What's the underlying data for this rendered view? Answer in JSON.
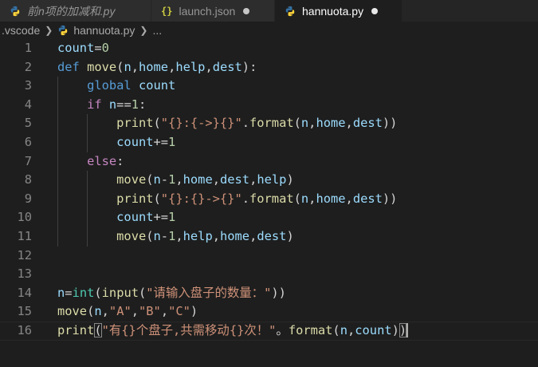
{
  "tabs": [
    {
      "label": "前n项的加减和.py",
      "icon": "python-icon",
      "active": false,
      "dirty": false,
      "italic": true
    },
    {
      "label": "launch.json",
      "icon": "json-icon",
      "active": false,
      "dirty": true,
      "italic": false
    },
    {
      "label": "hannuota.py",
      "icon": "python-icon",
      "active": true,
      "dirty": true,
      "italic": false
    }
  ],
  "json_icon_glyph": "{}",
  "breadcrumb": {
    "folder": ".vscode",
    "file": "hannuota.py",
    "ellipsis": "..."
  },
  "colors": {
    "background": "#1e1e1e",
    "tabbar": "#252526",
    "python_blue": "#3572a5",
    "python_yellow": "#ffd43b"
  },
  "lines": [
    {
      "num": "1",
      "indent": 0,
      "tokens": [
        [
          "var",
          "count"
        ],
        [
          "op",
          "="
        ],
        [
          "num",
          "0"
        ]
      ]
    },
    {
      "num": "2",
      "indent": 0,
      "tokens": [
        [
          "kw",
          "def "
        ],
        [
          "fn",
          "move"
        ],
        [
          "op",
          "("
        ],
        [
          "var",
          "n"
        ],
        [
          "op",
          ","
        ],
        [
          "var",
          "home"
        ],
        [
          "op",
          ","
        ],
        [
          "var",
          "help"
        ],
        [
          "op",
          ","
        ],
        [
          "var",
          "dest"
        ],
        [
          "op",
          "):"
        ]
      ]
    },
    {
      "num": "3",
      "indent": 1,
      "tokens": [
        [
          "kw",
          "global "
        ],
        [
          "var",
          "count"
        ]
      ]
    },
    {
      "num": "4",
      "indent": 1,
      "tokens": [
        [
          "ctl",
          "if "
        ],
        [
          "var",
          "n"
        ],
        [
          "op",
          "=="
        ],
        [
          "num",
          "1"
        ],
        [
          "op",
          ":"
        ]
      ]
    },
    {
      "num": "5",
      "indent": 2,
      "tokens": [
        [
          "fn",
          "print"
        ],
        [
          "op",
          "("
        ],
        [
          "str",
          "\"{}:{->}{}\""
        ],
        [
          "op",
          "."
        ],
        [
          "fn",
          "format"
        ],
        [
          "op",
          "("
        ],
        [
          "var",
          "n"
        ],
        [
          "op",
          ","
        ],
        [
          "var",
          "home"
        ],
        [
          "op",
          ","
        ],
        [
          "var",
          "dest"
        ],
        [
          "op",
          "))"
        ]
      ]
    },
    {
      "num": "6",
      "indent": 2,
      "tokens": [
        [
          "var",
          "count"
        ],
        [
          "op",
          "+="
        ],
        [
          "num",
          "1"
        ]
      ]
    },
    {
      "num": "7",
      "indent": 1,
      "tokens": [
        [
          "ctl",
          "else"
        ],
        [
          "op",
          ":"
        ]
      ]
    },
    {
      "num": "8",
      "indent": 2,
      "tokens": [
        [
          "fn",
          "move"
        ],
        [
          "op",
          "("
        ],
        [
          "var",
          "n"
        ],
        [
          "op",
          "-"
        ],
        [
          "num",
          "1"
        ],
        [
          "op",
          ","
        ],
        [
          "var",
          "home"
        ],
        [
          "op",
          ","
        ],
        [
          "var",
          "dest"
        ],
        [
          "op",
          ","
        ],
        [
          "var",
          "help"
        ],
        [
          "op",
          ")"
        ]
      ]
    },
    {
      "num": "9",
      "indent": 2,
      "tokens": [
        [
          "fn",
          "print"
        ],
        [
          "op",
          "("
        ],
        [
          "str",
          "\"{}:{}->{}\""
        ],
        [
          "op",
          "."
        ],
        [
          "fn",
          "format"
        ],
        [
          "op",
          "("
        ],
        [
          "var",
          "n"
        ],
        [
          "op",
          ","
        ],
        [
          "var",
          "home"
        ],
        [
          "op",
          ","
        ],
        [
          "var",
          "dest"
        ],
        [
          "op",
          "))"
        ]
      ]
    },
    {
      "num": "10",
      "indent": 2,
      "tokens": [
        [
          "var",
          "count"
        ],
        [
          "op",
          "+="
        ],
        [
          "num",
          "1"
        ]
      ]
    },
    {
      "num": "11",
      "indent": 2,
      "tokens": [
        [
          "fn",
          "move"
        ],
        [
          "op",
          "("
        ],
        [
          "var",
          "n"
        ],
        [
          "op",
          "-"
        ],
        [
          "num",
          "1"
        ],
        [
          "op",
          ","
        ],
        [
          "var",
          "help"
        ],
        [
          "op",
          ","
        ],
        [
          "var",
          "home"
        ],
        [
          "op",
          ","
        ],
        [
          "var",
          "dest"
        ],
        [
          "op",
          ")"
        ]
      ]
    },
    {
      "num": "12",
      "indent": 0,
      "tokens": []
    },
    {
      "num": "13",
      "indent": 0,
      "tokens": []
    },
    {
      "num": "14",
      "indent": 0,
      "tokens": [
        [
          "var",
          "n"
        ],
        [
          "op",
          "="
        ],
        [
          "type",
          "int"
        ],
        [
          "op",
          "("
        ],
        [
          "fn",
          "input"
        ],
        [
          "op",
          "("
        ],
        [
          "str",
          "\"请输入盘子的数量：\""
        ],
        [
          "op",
          "))"
        ]
      ]
    },
    {
      "num": "15",
      "indent": 0,
      "tokens": [
        [
          "fn",
          "move"
        ],
        [
          "op",
          "("
        ],
        [
          "var",
          "n"
        ],
        [
          "op",
          ","
        ],
        [
          "str",
          "\"A\""
        ],
        [
          "op",
          ","
        ],
        [
          "str",
          "\"B\""
        ],
        [
          "op",
          ","
        ],
        [
          "str",
          "\"C\""
        ],
        [
          "op",
          ")"
        ]
      ]
    },
    {
      "num": "16",
      "indent": 0,
      "current": true,
      "tokens": [
        [
          "fn",
          "print"
        ],
        [
          "bracket",
          "("
        ],
        [
          "str",
          "\"有{}个盘子,共需移动{}次！\""
        ],
        [
          "op",
          "。"
        ],
        [
          "fn",
          "format"
        ],
        [
          "op",
          "("
        ],
        [
          "var",
          "n"
        ],
        [
          "op",
          ","
        ],
        [
          "var",
          "count"
        ],
        [
          "op",
          ")"
        ],
        [
          "bracket",
          ")"
        ],
        [
          "cursor",
          ""
        ]
      ]
    }
  ]
}
